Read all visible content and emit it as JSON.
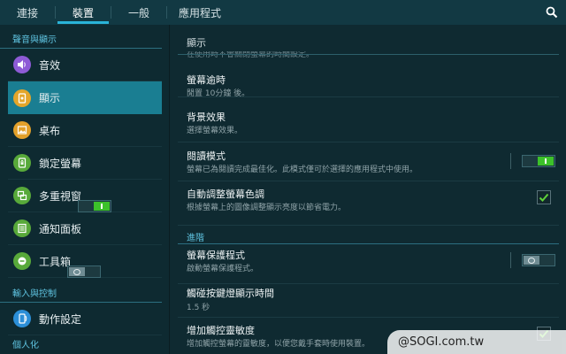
{
  "tabs": [
    {
      "label": "連接"
    },
    {
      "label": "裝置"
    },
    {
      "label": "一般"
    },
    {
      "label": "應用程式"
    }
  ],
  "active_tab": "裝置",
  "search_icon": "search-icon",
  "sidebar": {
    "sections": [
      {
        "header": "聲音與顯示"
      },
      {
        "header": "輸入與控制"
      },
      {
        "header": "個人化"
      }
    ],
    "items": [
      {
        "label": "音效",
        "icon": "volume-icon",
        "icon_color": "#8e5bd6"
      },
      {
        "label": "顯示",
        "icon": "display-icon",
        "icon_color": "#e4a62a",
        "selected": true
      },
      {
        "label": "桌布",
        "icon": "wallpaper-icon",
        "icon_color": "#e2a02a"
      },
      {
        "label": "鎖定螢幕",
        "icon": "lock-screen-icon",
        "icon_color": "#58a93a"
      },
      {
        "label": "多重視窗",
        "icon": "multi-window-icon",
        "icon_color": "#58a93a",
        "toggle": "on"
      },
      {
        "label": "通知面板",
        "icon": "notification-panel-icon",
        "icon_color": "#58a93a"
      },
      {
        "label": "工具箱",
        "icon": "toolbox-icon",
        "icon_color": "#58a93a",
        "toggle": "off"
      },
      {
        "label": "動作設定",
        "icon": "motion-icon",
        "icon_color": "#2c8fd8"
      }
    ]
  },
  "main": {
    "title": "顯示",
    "cut_text": "在使用時不會關閉螢幕的時間設定。",
    "settings": [
      {
        "title": "螢幕逾時",
        "subtitle": "閒置 10分鐘 後。"
      },
      {
        "title": "背景效果",
        "subtitle": "選擇螢幕效果。"
      },
      {
        "title": "閱讀模式",
        "subtitle": "螢幕已為閱讀完成最佳化。此模式僅可於選擇的應用程式中使用。",
        "toggle": "on"
      },
      {
        "title": "自動調整螢幕色調",
        "subtitle": "根據螢幕上的圖像調整顯示亮度以節省電力。",
        "checked": true
      },
      {
        "title": "螢幕保護程式",
        "subtitle": "啟動螢幕保護程式。",
        "toggle": "off"
      },
      {
        "title": "觸碰按鍵燈顯示時間",
        "subtitle": "1.5 秒"
      },
      {
        "title": "增加觸控靈敏度",
        "subtitle": "增加觸控螢幕的靈敏度，以便您戴手套時使用裝置。",
        "checked": true
      }
    ],
    "advanced_header": "進階"
  },
  "watermark": "@SOGI.com.tw",
  "colors": {
    "accent": "#2ab3d8",
    "selected_bg": "#1a7e92",
    "toggle_on": "#3cc12a",
    "section_header": "#5fc3e0"
  }
}
